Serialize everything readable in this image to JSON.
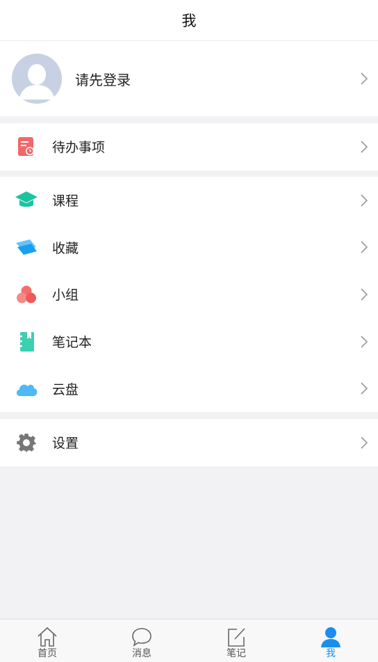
{
  "header": {
    "title": "我"
  },
  "profile": {
    "login_prompt": "请先登录"
  },
  "menu": {
    "todo": {
      "label": "待办事项",
      "icon": "todo-icon",
      "color": "#f0686a"
    },
    "courses": {
      "label": "课程",
      "icon": "graduation-cap-icon",
      "color": "#1cc3a0"
    },
    "favorites": {
      "label": "收藏",
      "icon": "favorites-icon",
      "color": "#1a9ff0"
    },
    "groups": {
      "label": "小组",
      "icon": "group-icon",
      "color": "#f26f6b"
    },
    "notebook": {
      "label": "笔记本",
      "icon": "notebook-icon",
      "color": "#3ccfb0"
    },
    "cloud": {
      "label": "云盘",
      "icon": "cloud-icon",
      "color": "#4fb8f7"
    },
    "settings": {
      "label": "设置",
      "icon": "gear-icon",
      "color": "#777777"
    }
  },
  "tabbar": {
    "items": [
      {
        "label": "首页",
        "icon": "home-icon"
      },
      {
        "label": "消息",
        "icon": "message-icon"
      },
      {
        "label": "笔记",
        "icon": "note-edit-icon"
      },
      {
        "label": "我",
        "icon": "user-icon",
        "active": true
      }
    ],
    "active_color": "#1a8ef0"
  }
}
